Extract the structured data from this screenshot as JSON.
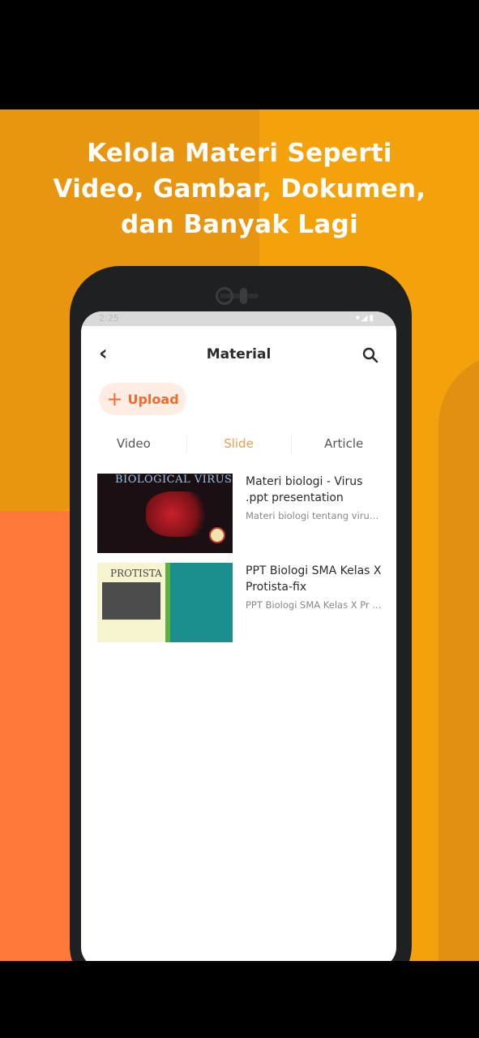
{
  "promo": {
    "headline_lines": [
      "Kelola Materi Seperti",
      "Video, Gambar, Dokumen,",
      "dan Banyak Lagi"
    ]
  },
  "status_bar": {
    "time": "2:25"
  },
  "app_bar": {
    "title": "Material",
    "back_icon": "chevron-left-icon",
    "search_icon": "search-icon"
  },
  "upload_button": {
    "label": "Upload",
    "icon": "plus-icon"
  },
  "tabs": [
    {
      "label": "Video",
      "active": false
    },
    {
      "label": "Slide",
      "active": true
    },
    {
      "label": "Article",
      "active": false
    }
  ],
  "materials": [
    {
      "title": "Materi biologi - Virus .ppt presentation",
      "description": "Materi biologi tentang virus ...",
      "thumb_text": "BIOLOGICAL VIRUS"
    },
    {
      "title": "PPT Biologi SMA Kelas X Protista-fix",
      "description": "PPT Biologi SMA Kelas X Pr ...",
      "thumb_text": "PROTISTA"
    }
  ],
  "colors": {
    "background": "#F4A20C",
    "accent": "#F26A2E",
    "tab_active": "#F39A4E",
    "coral": "#FF7A3A"
  }
}
